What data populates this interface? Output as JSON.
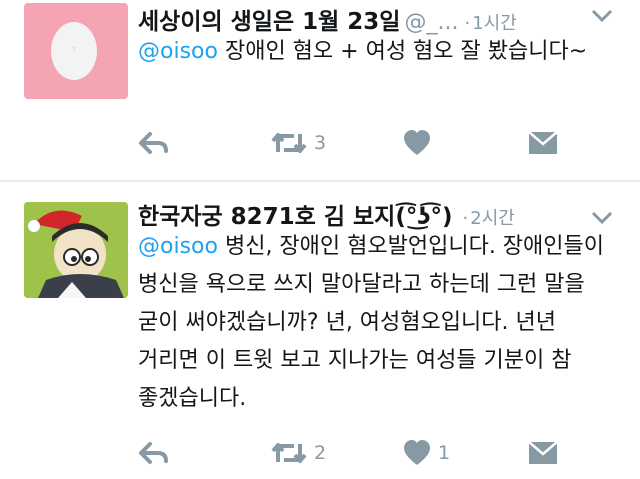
{
  "tweets": [
    {
      "author_name": "세상이의 생일은 1월 23일",
      "handle": "@_...",
      "separator": "·",
      "time": "1시간",
      "mention": "@oisoo",
      "body": " 장애인 혐오 + 여성 혐오 잘 봤습니다~",
      "actions": {
        "retweet_count": "3",
        "like_count": ""
      }
    },
    {
      "author_name": "한국자궁 8271호 김 보지(͡°͜ʖ͡°)",
      "handle": "",
      "separator": "·",
      "time": "2시간",
      "mention": "@oisoo",
      "body": " 병신, 장애인 혐오발언입니다. 장애인들이 병신을 욕으로 쓰지 말아달라고 하는데 그런 말을 굳이 써야겠습니까? 년, 여성혐오입니다. 년년 거리면 이 트윗 보고 지나가는 여성들 기분이 참 좋겠습니다.",
      "actions": {
        "retweet_count": "2",
        "like_count": "1"
      }
    }
  ],
  "colors": {
    "accent": "#1da1f2",
    "meta": "#8899a6",
    "icon": "#8899a6",
    "avatar1_bg": "#f4a4b2",
    "avatar2_bg": "#9fc24a"
  },
  "icons": [
    "reply-icon",
    "retweet-icon",
    "like-icon",
    "direct-message-icon",
    "chevron-down-icon"
  ]
}
